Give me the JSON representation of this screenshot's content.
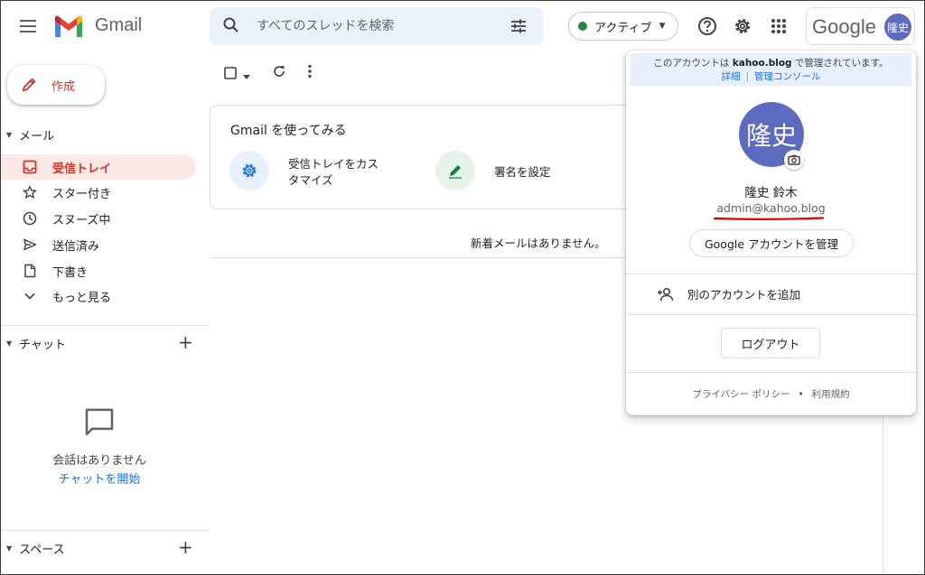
{
  "header": {
    "app_name": "Gmail",
    "search_placeholder": "すべてのスレッドを検索",
    "status_label": "アクティブ",
    "google_word": "Google",
    "avatar_initials": "隆史"
  },
  "sidebar": {
    "compose_label": "作成",
    "mail_section": "メール",
    "items": [
      {
        "label": "受信トレイ",
        "icon": "inbox-icon",
        "active": true
      },
      {
        "label": "スター付き",
        "icon": "star-icon"
      },
      {
        "label": "スヌーズ中",
        "icon": "clock-icon"
      },
      {
        "label": "送信済み",
        "icon": "send-icon"
      },
      {
        "label": "下書き",
        "icon": "draft-icon"
      },
      {
        "label": "もっと見る",
        "icon": "chevron-down-icon"
      }
    ],
    "chat_section": "チャット",
    "chat_empty": "会話はありません",
    "chat_start": "チャットを開始",
    "spaces_section": "スペース"
  },
  "main": {
    "card_title": "Gmail を使ってみる",
    "card_item1": "受信トレイをカス\nタマイズ",
    "card_item1_line1": "受信トレイをカス",
    "card_item1_line2": "タマイズ",
    "card_item2": "署名を設定",
    "empty_message": "新着メールはありません。"
  },
  "account_popup": {
    "managed_prefix": "このアカウントは ",
    "managed_domain": "kahoo.blog",
    "managed_suffix": " で管理されています。",
    "link_details": "詳細",
    "link_admin": "管理コンソール",
    "avatar_initials": "隆史",
    "name": "隆史 鈴木",
    "email": "admin@kahoo.blog",
    "manage_button": "Google アカウントを管理",
    "add_account": "別のアカウントを追加",
    "logout_button": "ログアウト",
    "privacy": "プライバシー ポリシー",
    "terms": "利用規約"
  },
  "colors": {
    "accent_red": "#d93025",
    "link_blue": "#1a73e8",
    "avatar_bg": "#5c6bc0",
    "status_green": "#1e8e3e",
    "active_bg": "#fce8e6"
  }
}
